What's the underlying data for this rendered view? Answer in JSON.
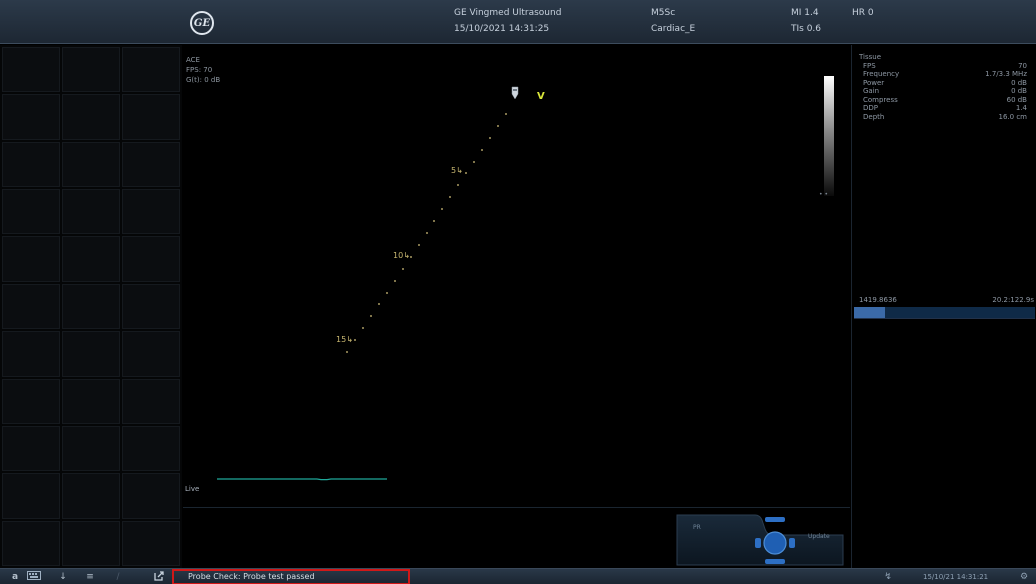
{
  "header": {
    "logo_text": "GE",
    "system_name": "GE Vingmed Ultrasound",
    "datetime": "15/10/2021 14:31:25",
    "probe": "M5Sc",
    "preset": "Cardiac_E",
    "mi": "MI 1.4",
    "tis": "TIs 0.6",
    "hr": "HR 0"
  },
  "image": {
    "overlay": [
      "ACE",
      "FPS: 70",
      "G(t): 0 dB"
    ],
    "orientation_marker": "V",
    "depth_labels": [
      "5",
      "10",
      "15"
    ],
    "live_label": "Live",
    "ecg_color": "#1fa89a"
  },
  "controls": {
    "left_label": "PR",
    "right_label": "Update"
  },
  "info_panel": {
    "title": "Tissue",
    "rows": [
      {
        "label": "FPS",
        "value": "70"
      },
      {
        "label": "Frequency",
        "value": "1.7/3.3 MHz"
      },
      {
        "label": "Power",
        "value": "0 dB"
      },
      {
        "label": "Gain",
        "value": "0 dB"
      },
      {
        "label": "Compress",
        "value": "60 dB"
      },
      {
        "label": "DDP",
        "value": "1.4"
      },
      {
        "label": "Depth",
        "value": "16.0 cm"
      }
    ],
    "cine_left": "1419.8636",
    "cine_right": "20.2:122.9s",
    "cine_progress": 0.17
  },
  "statusbar": {
    "icons": [
      "a",
      "keyboard-icon",
      "download-icon",
      "list-icon",
      "pen-icon",
      "export-icon"
    ],
    "message": "Probe Check: Probe test passed",
    "datetime": "15/10/21 14:31:21",
    "highlight_color": "#d01818"
  }
}
